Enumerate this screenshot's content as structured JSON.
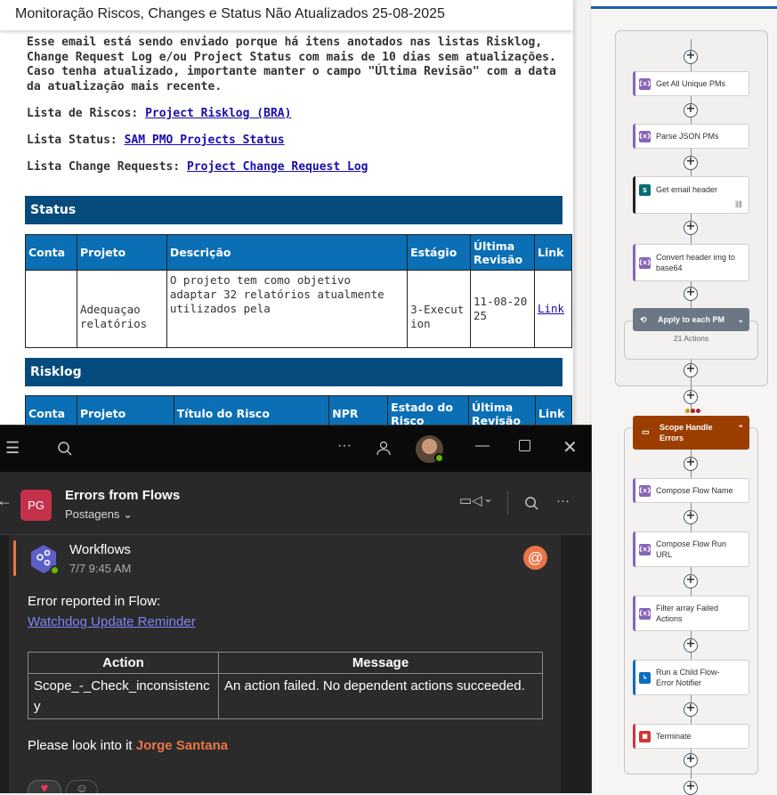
{
  "email": {
    "subject": "Monitoração Riscos, Changes e Status Não Atualizados  25-08-2025",
    "intro": [
      "Esse email está sendo enviado porque há itens anotados nas listas Risklog,",
      "Change Request Log e/ou Project Status com mais de 10 dias sem atualizações.",
      "Caso tenha atualizado, importante manter o campo \"Última Revisão\" com a data",
      "da atualização mais recente."
    ],
    "lists": [
      {
        "label": "Lista de Riscos: ",
        "link": "Project Risklog (BRA)"
      },
      {
        "label": "Lista Status: ",
        "link": "SAM PMO Projects Status"
      },
      {
        "label": "Lista Change Requests: ",
        "link": "Project Change Request Log"
      }
    ],
    "status": {
      "heading": "Status",
      "columns": [
        "Conta",
        "Projeto",
        "Descrição",
        "Estágio",
        "Última Revisão",
        "Link"
      ],
      "row": {
        "conta": "",
        "projeto": "Adequaçao relatórios",
        "descricao": "O projeto tem como objetivo adaptar 32 relatórios atualmente utilizados pela",
        "estagio": "3-Execution",
        "revisao": "11-08-2025",
        "link": "Link"
      }
    },
    "risklog": {
      "heading": "Risklog",
      "columns": [
        "Conta",
        "Projeto",
        "Título do Risco",
        "NPR",
        "Estado do Risco",
        "Última Revisão",
        "Link"
      ]
    }
  },
  "teams": {
    "channel_initials": "PG",
    "channel_name": "Errors from Flows",
    "channel_tab": "Postagens",
    "sender": "Workflows",
    "time": "7/7 9:45 AM",
    "line1": "Error reported in Flow:",
    "flow_link": "Watchdog Update Reminder",
    "table": {
      "headers": [
        "Action",
        "Message"
      ],
      "action": "Scope_-_Check_inconsistency",
      "message": "An action failed. No dependent actions succeeded."
    },
    "closing": "Please look into it ",
    "mention": "Jorge Santana",
    "colors": {
      "accent": "#e97548",
      "link": "#7f85f5",
      "channel_avatar": "#c4314b"
    }
  },
  "flow": {
    "steps": [
      {
        "label": "Get All Unique PMs",
        "icon": "variable-icon",
        "color": "#8764b8"
      },
      {
        "label": "Parse JSON PMs",
        "icon": "variable-icon",
        "color": "#8764b8"
      },
      {
        "label": "Get email header",
        "icon": "sharepoint-icon",
        "color": "#036c70"
      },
      {
        "label": "Convert header img to base64",
        "icon": "variable-icon",
        "color": "#8764b8"
      }
    ],
    "loop": {
      "label": "Apply to each PM",
      "sub": "21 Actions"
    },
    "scope": {
      "label": "Scope Handle Errors",
      "color": "#9c3d00"
    },
    "scope_steps": [
      {
        "label": "Compose Flow Name",
        "icon": "variable-icon",
        "color": "#8764b8"
      },
      {
        "label": "Compose Flow Run URL",
        "icon": "variable-icon",
        "color": "#8764b8"
      },
      {
        "label": "Filter array Failed Actions",
        "icon": "variable-icon",
        "color": "#8764b8"
      },
      {
        "label": "Run a Child Flow-Error Notifier",
        "icon": "child-flow-icon",
        "color": "#0f6cbd"
      },
      {
        "label": "Terminate",
        "icon": "terminate-icon",
        "color": "#d13438"
      }
    ]
  }
}
